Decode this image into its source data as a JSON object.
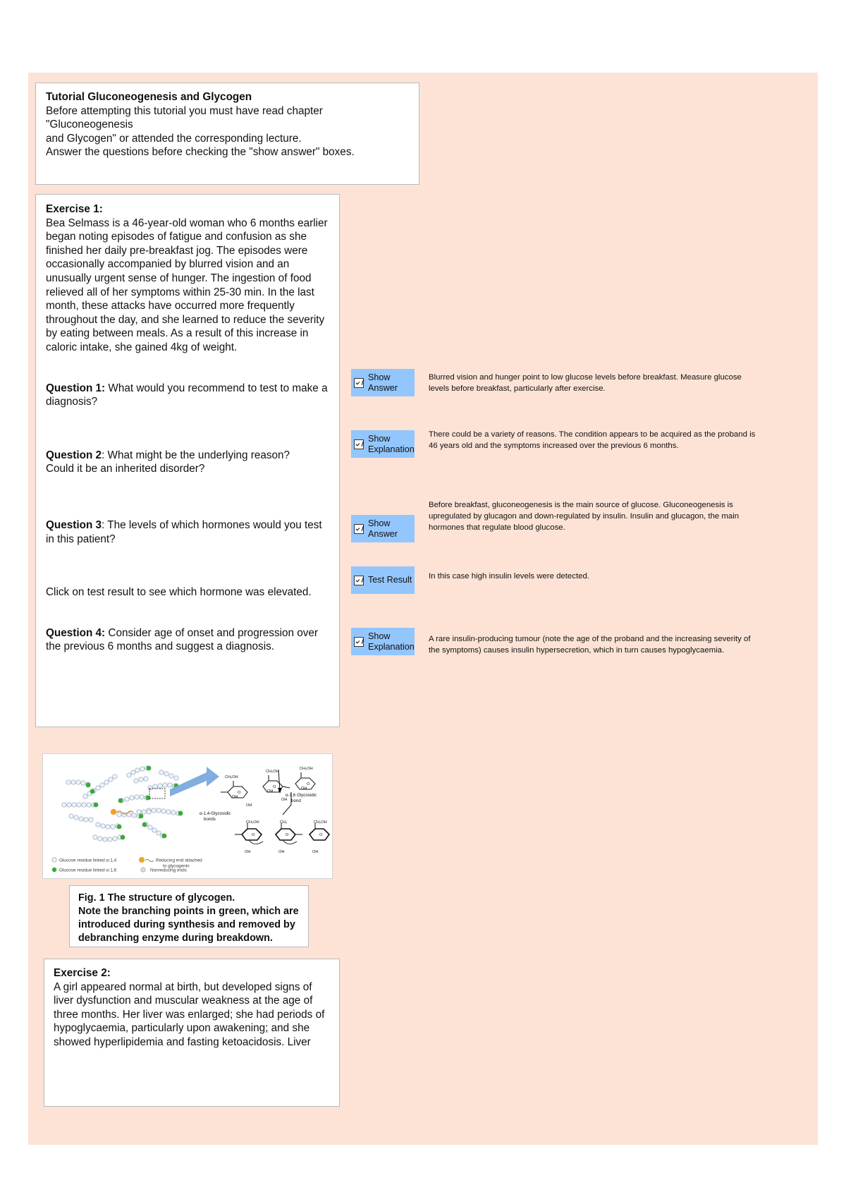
{
  "page": {
    "background": "#ffffff",
    "slide_background": "#fce3d6"
  },
  "intro": {
    "title": "Tutorial Gluconeogenesis and Glycogen",
    "line1": "Before attempting this tutorial you must have read chapter \"Gluconeogenesis",
    "line2": "and Glycogen\" or attended the corresponding lecture.",
    "line3": "Answer the questions before checking the \"show answer\" boxes."
  },
  "exercise1": {
    "heading": "Exercise 1:",
    "body": "Bea Selmass is a 46-year-old woman who 6 months earlier began noting episodes of fatigue and confusion as she finished her daily pre-breakfast jog. The episodes were occasionally accompanied by blurred vision and an unusually urgent sense of hunger. The ingestion of food relieved all of her symptoms within 25-30 min. In the last month, these attacks have occurred more frequently throughout the day, and she learned to reduce the severity by eating between meals. As a result of this increase in caloric intake, she gained 4kg of weight.",
    "q1_label": "Question 1:",
    "q1_text": " What would you recommend to test to make a diagnosis?",
    "q2_label": "Question 2",
    "q2_text": ": What might be the underlying reason?",
    "q2_text2": " Could it be an inherited disorder?",
    "q3_label": "Question 3",
    "q3_text": ": The levels of which hormones would you test in this patient?",
    "click_note": "Click on test result to see which hormone was elevated.",
    "q4_label": "Question 4:",
    "q4_text": " Consider age of onset and progression over the previous 6 months and suggest a diagnosis."
  },
  "answers": [
    {
      "button_label": "Show\nAnswer",
      "text": "Blurred vision and hunger point to low glucose levels before breakfast. Measure glucose levels before breakfast, particularly after exercise."
    },
    {
      "button_label": "Show\nExplanation",
      "text": "There could be a variety of reasons. The condition appears to be acquired as the proband is 46 years old and the symptoms increased over the previous 6 months."
    },
    {
      "button_label": "Show\nAnswer",
      "text": "Before breakfast, gluconeogenesis is the main source of glucose. Gluconeogenesis is upregulated by glucagon and down-regulated by insulin. Insulin and glucagon, the main hormones that regulate blood glucose."
    },
    {
      "button_label": "Test Result",
      "text": "In this case high insulin levels were detected."
    },
    {
      "button_label": "Show\nExplanation",
      "text": "A rare insulin-producing tumour (note the age of the proband and the increasing severity of the symptoms) causes insulin hypersecretion, which in turn causes hypoglycaemia."
    }
  ],
  "figure": {
    "legend": [
      "Glucose residue linked α-1,4",
      "Glucose residue linked α-1,6",
      "Reducing end attached",
      "to glycogenin",
      "Nonreducing ends"
    ],
    "labels": [
      "α-1,4-Glycosidic",
      "bonds",
      "α-1,6 Glycosidic",
      "bond",
      "CH₂OH",
      "OH",
      "O"
    ],
    "colors": {
      "branch_green": "#3aa83a",
      "reducing_orange": "#f0a22e",
      "residue_fill": "#eef3fa",
      "arrow_blue": "#7aa9dd"
    }
  },
  "figure_caption": {
    "line1": "Fig. 1 The structure of glycogen.",
    "line2": "Note the branching points in green, which are",
    "line3": "introduced during synthesis and removed by",
    "line4": "debranching enzyme during breakdown."
  },
  "exercise2": {
    "heading": "Exercise 2:",
    "body": "A girl appeared normal at birth, but developed signs of liver dysfunction and muscular weakness at the age of three months. Her liver was enlarged; she had periods of hypoglycaemia, particularly upon awakening; and she showed hyperlipidemia and fasting ketoacidosis. Liver"
  }
}
